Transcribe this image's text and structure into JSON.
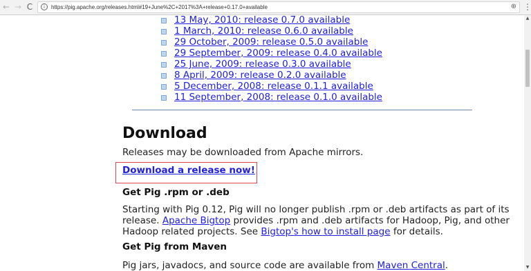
{
  "browser": {
    "url": "https://pig.apache.org/releases.html#19+June%2C+2017%3A+release+0.17.0+available",
    "back_glyph": "←",
    "forward_glyph": "→",
    "reload_glyph": "C",
    "info_glyph": "i",
    "zoom_glyph": "⊕",
    "menu_glyph": "⋮"
  },
  "releases": [
    {
      "label": "13 May, 2010: release 0.7.0 available"
    },
    {
      "label": "1 March, 2010: release 0.6.0 available"
    },
    {
      "label": "29 October, 2009: release 0.5.0 available"
    },
    {
      "label": "29 September, 2009: release 0.4.0 available"
    },
    {
      "label": "25 June, 2009: release 0.3.0 available"
    },
    {
      "label": "8 April, 2009: release 0.2.0 available"
    },
    {
      "label": "5 December, 2008: release 0.1.1 available"
    },
    {
      "label": "11 September, 2008: release 0.1.0 available"
    }
  ],
  "download": {
    "heading": "Download",
    "intro": "Releases may be downloaded from Apache mirrors.",
    "release_link": "Download a release now!"
  },
  "rpm_section": {
    "heading": "Get Pig .rpm or .deb",
    "text_1": "Starting with Pig 0.12, Pig will no longer publish .rpm or .deb artifacts as part of its release.",
    "link_1": "Apache Bigtop",
    "text_2": "provides .rpm and .deb artifacts for Hadoop, Pig, and other Hadoop related projects. See",
    "link_2": "Bigtop's how to install page",
    "text_3": "for details."
  },
  "maven_section": {
    "heading": "Get Pig from Maven",
    "text_1": "Pig jars, javadocs, and source code are available from",
    "link_1": "Maven Central",
    "text_2": "."
  },
  "scrollbar": {
    "up_glyph": "▲",
    "down_glyph": "▼"
  },
  "colors": {
    "link": "#2020dd",
    "highlight_border": "#e0474c",
    "bullet": "#bcd6ee"
  }
}
